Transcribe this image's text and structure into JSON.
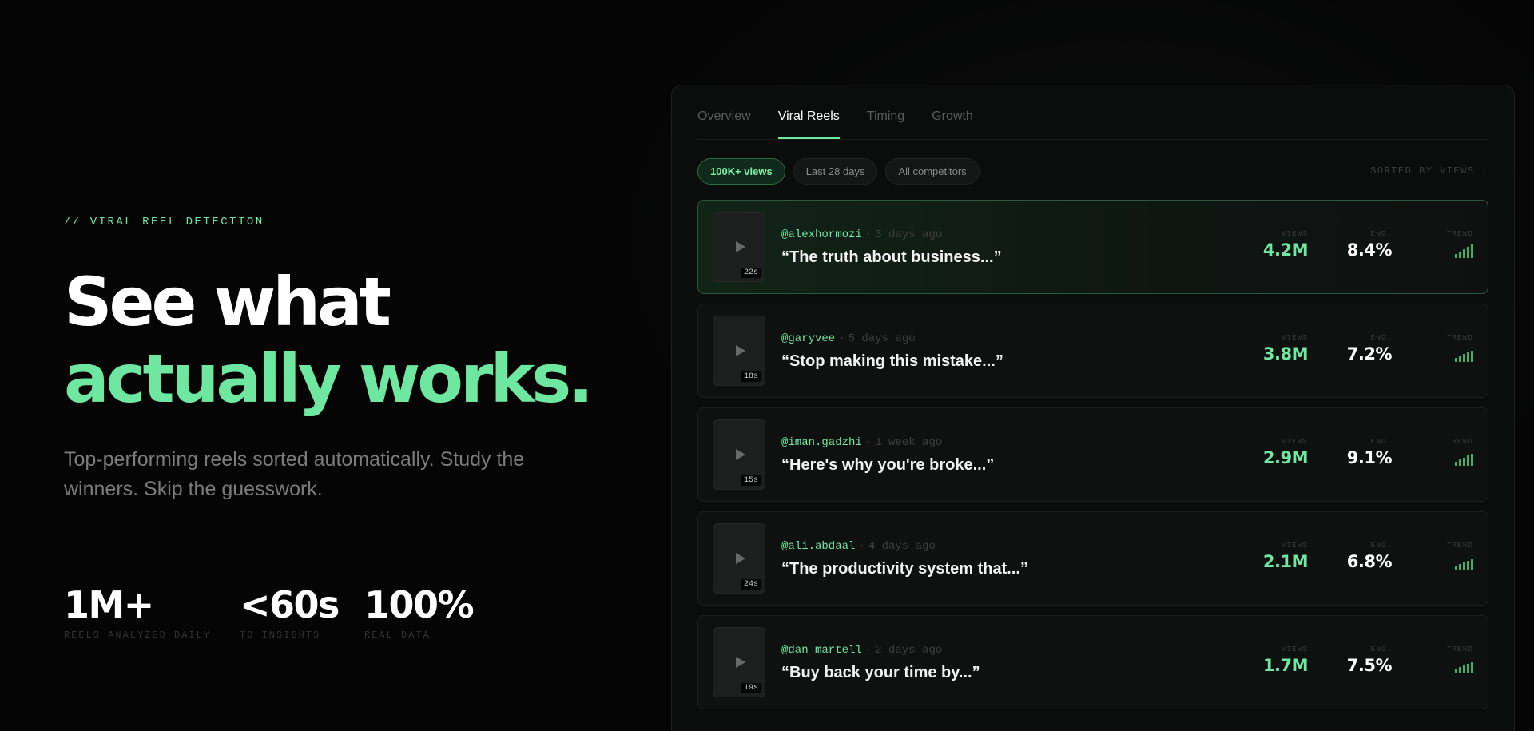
{
  "hero": {
    "eyebrow": "// VIRAL REEL DETECTION",
    "headline_line1": "See what",
    "headline_line2": "actually works.",
    "subtitle": "Top-performing reels sorted automatically. Study the winners. Skip the guesswork.",
    "stats": [
      {
        "value": "1M+",
        "label": "REELS ANALYZED DAILY"
      },
      {
        "value": "<60s",
        "label": "TO INSIGHTS"
      },
      {
        "value": "100%",
        "label": "REAL DATA"
      }
    ]
  },
  "panel": {
    "tabs": [
      {
        "label": "Overview",
        "active": false
      },
      {
        "label": "Viral Reels",
        "active": true
      },
      {
        "label": "Timing",
        "active": false
      },
      {
        "label": "Growth",
        "active": false
      }
    ],
    "filters": [
      {
        "label": "100K+ views",
        "active": true
      },
      {
        "label": "Last 28 days",
        "active": false
      },
      {
        "label": "All competitors",
        "active": false
      }
    ],
    "sort_label": "SORTED BY VIEWS ↓",
    "metric_labels": {
      "views": "VIEWS",
      "eng": "ENG.",
      "trend": "TREND"
    },
    "reels": [
      {
        "handle": "@alexhormozi",
        "time_ago": "3 days ago",
        "caption": "“The truth about business...”",
        "duration": "22s",
        "views": "4.2M",
        "eng": "8.4%",
        "highlight": true
      },
      {
        "handle": "@garyvee",
        "time_ago": "5 days ago",
        "caption": "“Stop making this mistake...”",
        "duration": "18s",
        "views": "3.8M",
        "eng": "7.2%",
        "highlight": false
      },
      {
        "handle": "@iman.gadzhi",
        "time_ago": "1 week ago",
        "caption": "“Here's why you're broke...”",
        "duration": "15s",
        "views": "2.9M",
        "eng": "9.1%",
        "highlight": false
      },
      {
        "handle": "@ali.abdaal",
        "time_ago": "4 days ago",
        "caption": "“The productivity system that...”",
        "duration": "24s",
        "views": "2.1M",
        "eng": "6.8%",
        "highlight": false
      },
      {
        "handle": "@dan_martell",
        "time_ago": "2 days ago",
        "caption": "“Buy back your time by...”",
        "duration": "19s",
        "views": "1.7M",
        "eng": "7.5%",
        "highlight": false
      }
    ]
  },
  "colors": {
    "accent": "#6ee7a0",
    "background": "#050505",
    "panel": "#0b0c0c"
  },
  "icons": {
    "play": "play-icon",
    "trend": "bar-chart-icon"
  }
}
